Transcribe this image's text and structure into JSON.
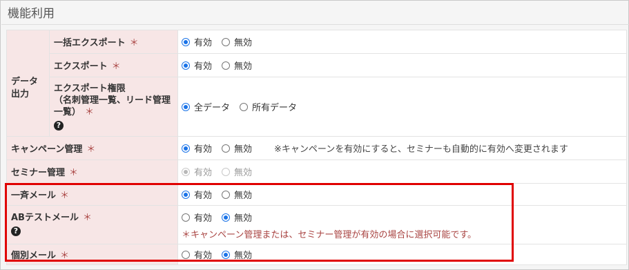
{
  "panel": {
    "title": "機能利用"
  },
  "rows": {
    "data_output_group": "データ\n出力",
    "bulk_export": {
      "label": "一括エクスポート",
      "options": [
        "有効",
        "無効"
      ]
    },
    "export": {
      "label": "エクスポート",
      "options": [
        "有効",
        "無効"
      ]
    },
    "export_permission": {
      "label_line1": "エクスポート権限",
      "label_line2": "（名刺管理一覧、リード管理",
      "label_line3": "一覧）",
      "options": [
        "全データ",
        "所有データ"
      ]
    },
    "campaign": {
      "label": "キャンペーン管理",
      "options": [
        "有効",
        "無効"
      ],
      "note": "※キャンペーンを有効にすると、セミナーも自動的に有効へ変更されます"
    },
    "seminar": {
      "label": "セミナー管理",
      "options": [
        "有効",
        "無効"
      ]
    },
    "bulk_mail": {
      "label": "一斉メール",
      "options": [
        "有効",
        "無効"
      ]
    },
    "ab_test_mail": {
      "label": "ABテストメール",
      "options": [
        "有効",
        "無効"
      ],
      "warning": "＊キャンペーン管理または、セミナー管理が有効の場合に選択可能です。"
    },
    "individual_mail": {
      "label": "個別メール",
      "options": [
        "有効",
        "無効"
      ]
    }
  },
  "required_mark": "＊",
  "help_icon_glyph": "?",
  "selected": {
    "bulk_export": "有効",
    "export": "有効",
    "export_permission": "全データ",
    "campaign": "有効",
    "seminar": "有効",
    "bulk_mail": "有効",
    "ab_test_mail": "無効",
    "individual_mail": "無効"
  },
  "colors": {
    "label_bg": "#f7e6e6",
    "radio_checked": "#1a73e8",
    "required": "#a94442",
    "highlight_box": "#e00000"
  }
}
